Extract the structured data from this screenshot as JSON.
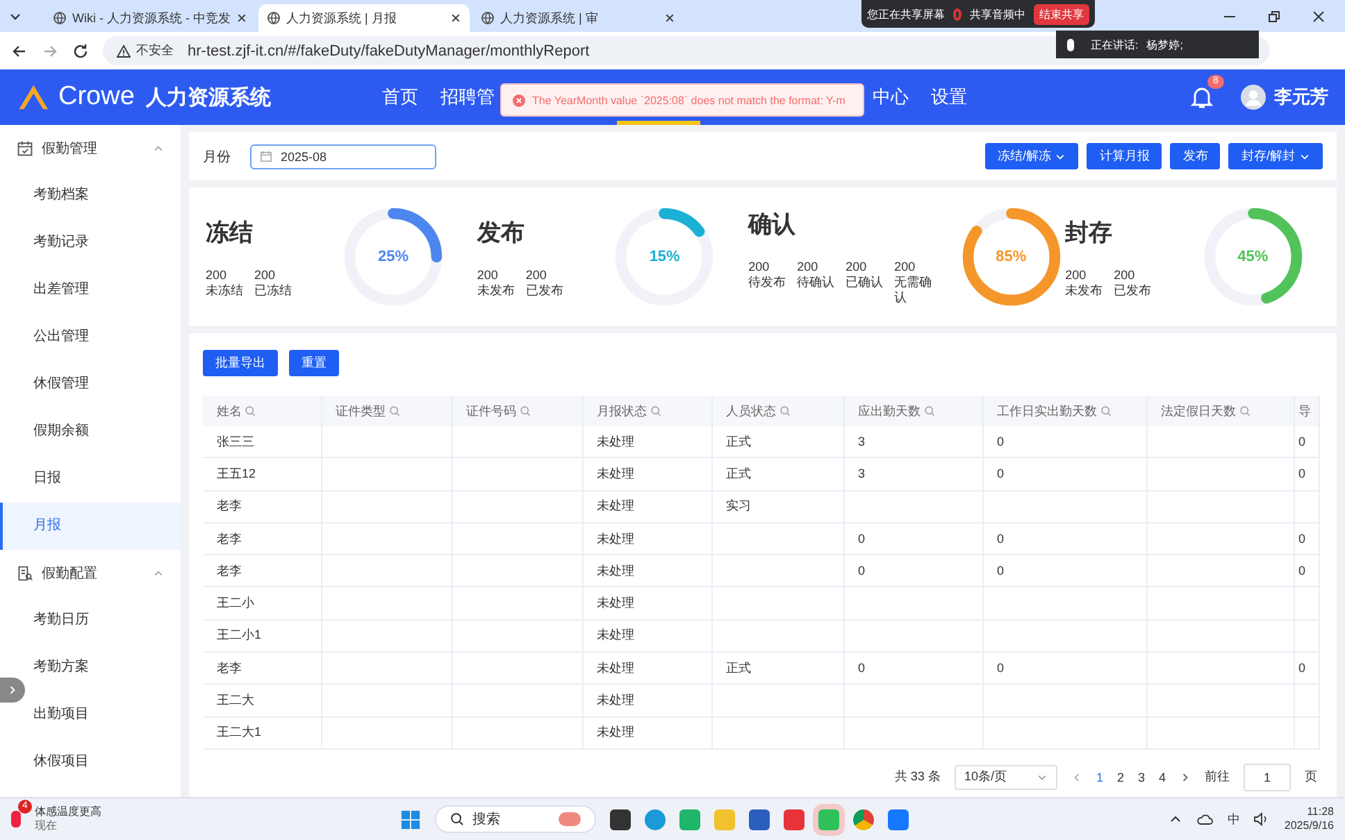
{
  "browser": {
    "tabs": [
      {
        "title": "Wiki - 人力资源系统 - 中竞发",
        "selected": false
      },
      {
        "title": "人力资源系统 | 月报",
        "selected": true
      },
      {
        "title": "人力资源系统 | 审",
        "selected": false
      }
    ],
    "security": "不安全",
    "url": "hr-test.zjf-it.cn/#/fakeDuty/fakeDutyManager/monthlyReport"
  },
  "share_bar": {
    "status": "您正在共享屏幕",
    "audio": "共享音频中",
    "stop": "结束共享"
  },
  "speaker": {
    "label": "正在讲话:",
    "name": "杨梦婷;"
  },
  "header": {
    "brand": "Crowe",
    "system": "人力资源系统",
    "nav": [
      {
        "label": "首页",
        "selected": false
      },
      {
        "label": "招聘管",
        "selected": false
      },
      {
        "label": "中心",
        "selected": false
      },
      {
        "label": "设置",
        "selected": false
      }
    ],
    "notifications": "8",
    "user": "李元芳"
  },
  "toast": {
    "message": "The YearMonth value `2025:08` does not match the format: Y-m"
  },
  "sidebar": {
    "groups": [
      {
        "label": "假勤管理",
        "expanded": true,
        "kind": "calendar",
        "children": [
          {
            "label": "考勤档案",
            "selected": false
          },
          {
            "label": "考勤记录",
            "selected": false
          },
          {
            "label": "出差管理",
            "selected": false
          },
          {
            "label": "公出管理",
            "selected": false
          },
          {
            "label": "休假管理",
            "selected": false
          },
          {
            "label": "假期余额",
            "selected": false
          },
          {
            "label": "日报",
            "selected": false
          },
          {
            "label": "月报",
            "selected": true
          }
        ]
      },
      {
        "label": "假勤配置",
        "expanded": true,
        "kind": "document",
        "children": [
          {
            "label": "考勤日历",
            "selected": false
          },
          {
            "label": "考勤方案",
            "selected": false
          },
          {
            "label": "出勤项目",
            "selected": false
          },
          {
            "label": "休假项目",
            "selected": false
          }
        ]
      }
    ]
  },
  "filter": {
    "label": "月份",
    "value": "2025-08",
    "buttons": [
      {
        "label": "冻结/解冻",
        "dropdown": true
      },
      {
        "label": "计算月报",
        "dropdown": false
      },
      {
        "label": "发布",
        "dropdown": false
      },
      {
        "label": "封存/解封",
        "dropdown": true
      }
    ]
  },
  "stats": [
    {
      "title": "冻结",
      "percent": "25%",
      "level": 0.25,
      "color": "#4e86f0",
      "counts": [
        {
          "value": "200",
          "label": "未冻结"
        },
        {
          "value": "200",
          "label": "已冻结"
        }
      ]
    },
    {
      "title": "发布",
      "percent": "15%",
      "level": 0.15,
      "color": "#1cb0d6",
      "counts": [
        {
          "value": "200",
          "label": "未发布"
        },
        {
          "value": "200",
          "label": "已发布"
        }
      ]
    },
    {
      "title": "确认",
      "percent": "85%",
      "level": 0.85,
      "color": "#f5962a",
      "counts": [
        {
          "value": "200",
          "label": "待发布"
        },
        {
          "value": "200",
          "label": "待确认"
        },
        {
          "value": "200",
          "label": "已确认"
        },
        {
          "value": "200",
          "label": "无需确认"
        }
      ]
    },
    {
      "title": "封存",
      "percent": "45%",
      "level": 0.45,
      "color": "#52c25a",
      "counts": [
        {
          "value": "200",
          "label": "未发布"
        },
        {
          "value": "200",
          "label": "已发布"
        }
      ]
    }
  ],
  "table": {
    "actions": [
      "批量导出",
      "重置"
    ],
    "columns": [
      "姓名",
      "证件类型",
      "证件号码",
      "月报状态",
      "人员状态",
      "应出勤天数",
      "工作日实出勤天数",
      "法定假日天数",
      "导"
    ],
    "rows": [
      {
        "name": "张三三",
        "month_status": "未处理",
        "person_status": "正式",
        "due_days": "3",
        "workday_days": "0",
        "column_9": "0"
      },
      {
        "name": "王五12",
        "month_status": "未处理",
        "person_status": "正式",
        "due_days": "3",
        "workday_days": "0",
        "column_9": "0"
      },
      {
        "name": "老李",
        "month_status": "未处理",
        "person_status": "实习"
      },
      {
        "name": "老李",
        "month_status": "未处理",
        "due_days": "0",
        "workday_days": "0",
        "column_9": "0"
      },
      {
        "name": "老李",
        "month_status": "未处理",
        "due_days": "0",
        "workday_days": "0",
        "column_9": "0"
      },
      {
        "name": "王二小",
        "month_status": "未处理"
      },
      {
        "name": "王二小1",
        "month_status": "未处理"
      },
      {
        "name": "老李",
        "month_status": "未处理",
        "person_status": "正式",
        "due_days": "0",
        "workday_days": "0",
        "column_9": "0"
      },
      {
        "name": "王二大",
        "month_status": "未处理"
      },
      {
        "name": "王二大1",
        "month_status": "未处理"
      }
    ]
  },
  "pagination": {
    "total": "共 33 条",
    "page_size": "10条/页",
    "pages": [
      {
        "label": "1",
        "selected": true
      },
      {
        "label": "2",
        "selected": false
      },
      {
        "label": "3",
        "selected": false
      },
      {
        "label": "4",
        "selected": false
      }
    ],
    "goto_label": "前往",
    "goto_value": "1",
    "goto_unit": "页"
  },
  "taskbar": {
    "weather_badge": "4",
    "weather_title": "体感温度更高",
    "weather_sub": "现在",
    "search": "搜索",
    "ime": "中",
    "time": "11:28",
    "date": "2025/9/16"
  }
}
